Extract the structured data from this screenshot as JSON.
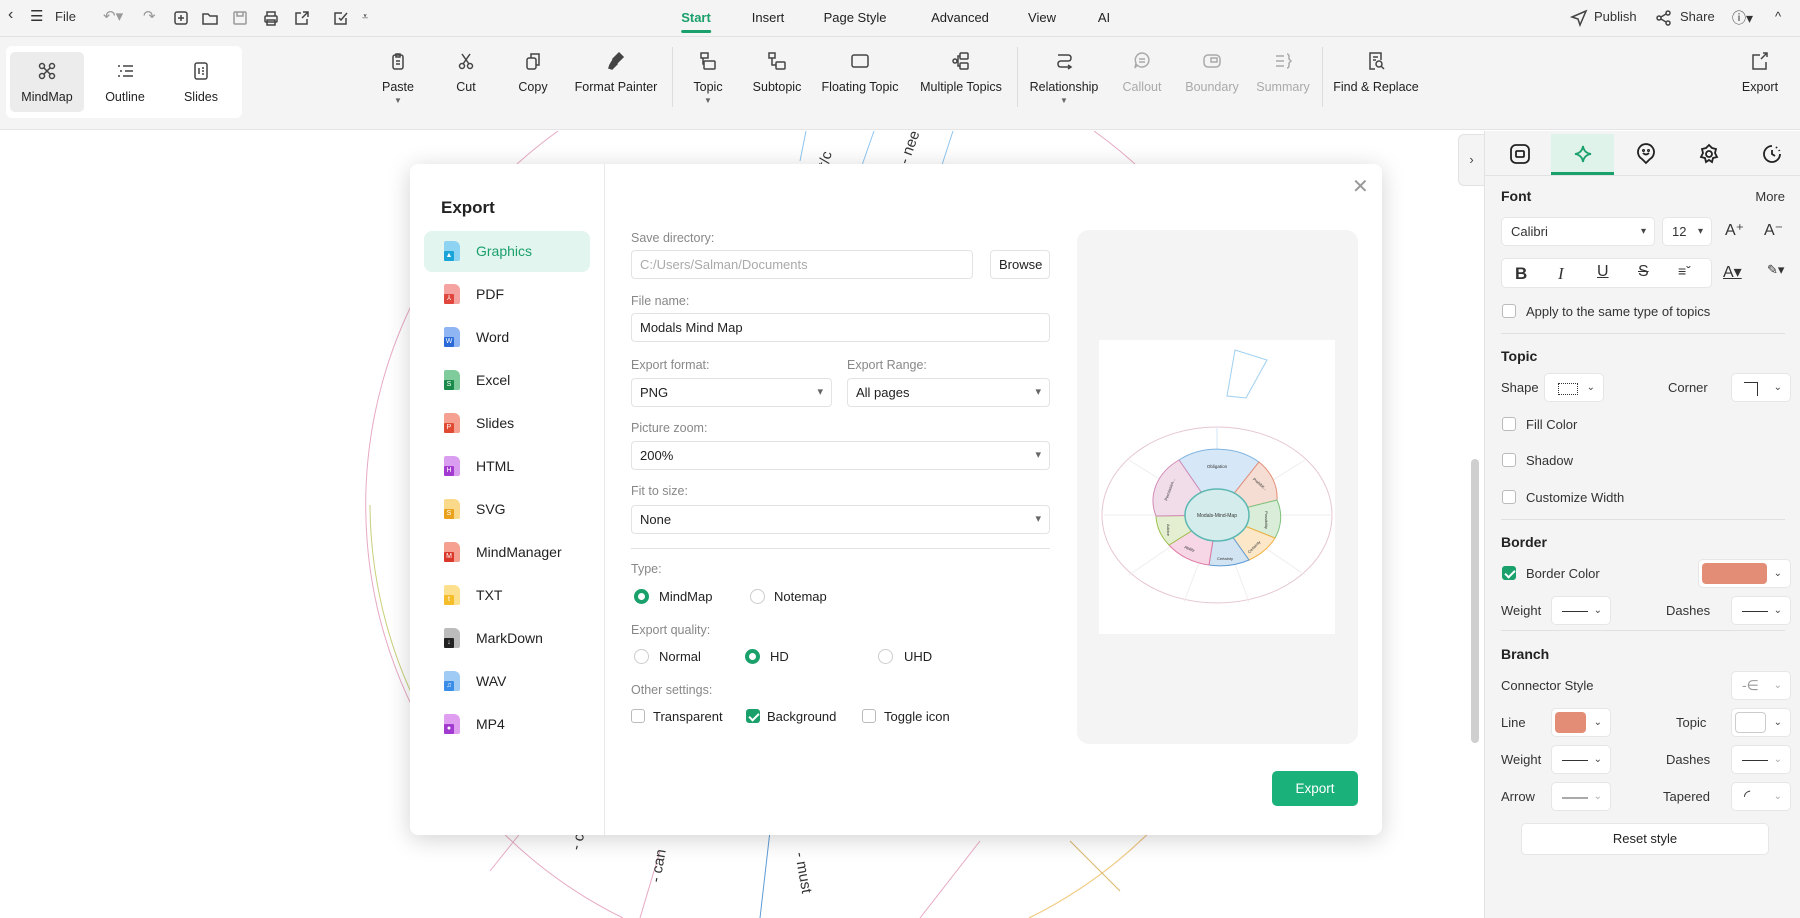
{
  "topbar": {
    "file": "File",
    "tabs": [
      "Start",
      "Insert",
      "Page Style",
      "Advanced",
      "View",
      "AI"
    ],
    "active_tab": "Start",
    "publish": "Publish",
    "share": "Share"
  },
  "views": [
    "MindMap",
    "Outline",
    "Slides"
  ],
  "ribbon": {
    "paste": "Paste",
    "cut": "Cut",
    "copy": "Copy",
    "format_painter": "Format Painter",
    "topic": "Topic",
    "subtopic": "Subtopic",
    "floating_topic": "Floating Topic",
    "multiple_topics": "Multiple Topics",
    "relationship": "Relationship",
    "callout": "Callout",
    "boundary": "Boundary",
    "summary": "Summary",
    "find_replace": "Find & Replace",
    "export": "Export"
  },
  "canvas": {
    "labels": [
      "- cou",
      "- can",
      "- must",
      "n't/c",
      "- nee"
    ]
  },
  "dialog": {
    "title": "Export",
    "formats": [
      "Graphics",
      "PDF",
      "Word",
      "Excel",
      "Slides",
      "HTML",
      "SVG",
      "MindManager",
      "TXT",
      "MarkDown",
      "WAV",
      "MP4"
    ],
    "active_format": "Graphics",
    "save_dir_label": "Save directory:",
    "save_dir_placeholder": "C:/Users/Salman/Documents",
    "browse": "Browse",
    "file_name_label": "File name:",
    "file_name": "Modals Mind Map",
    "format_label": "Export format:",
    "format": "PNG",
    "range_label": "Export Range:",
    "range": "All pages",
    "zoom_label": "Picture zoom:",
    "zoom": "200%",
    "fit_label": "Fit to size:",
    "fit": "None",
    "type_label": "Type:",
    "types": [
      "MindMap",
      "Notemap"
    ],
    "type_selected": "MindMap",
    "quality_label": "Export quality:",
    "qualities": [
      "Normal",
      "HD",
      "UHD"
    ],
    "quality_selected": "HD",
    "other_label": "Other settings:",
    "other": [
      {
        "label": "Transparent",
        "checked": false
      },
      {
        "label": "Background",
        "checked": true
      },
      {
        "label": "Toggle icon",
        "checked": false
      }
    ],
    "export_button": "Export",
    "preview": {
      "center": "Modals-Mind-Map",
      "branches": [
        "Obligation",
        "Prohibit...",
        "Possibility",
        "Certainty",
        "Certainty",
        "Ability",
        "Advice",
        "Permission..."
      ]
    }
  },
  "panel": {
    "font": {
      "heading": "Font",
      "more": "More",
      "family": "Calibri",
      "size": "12",
      "apply_same": "Apply to the same type of topics"
    },
    "topic": {
      "heading": "Topic",
      "shape": "Shape",
      "corner": "Corner",
      "fill_color": "Fill Color",
      "shadow": "Shadow",
      "customize_width": "Customize Width"
    },
    "border": {
      "heading": "Border",
      "border_color": "Border Color",
      "border_color_checked": true,
      "color": "#e38d77",
      "weight": "Weight",
      "dashes": "Dashes"
    },
    "branch": {
      "heading": "Branch",
      "connector_style": "Connector Style",
      "line": "Line",
      "line_color": "#e38d77",
      "topic": "Topic",
      "topic_color": "#ffffff",
      "weight": "Weight",
      "dashes": "Dashes",
      "arrow": "Arrow",
      "tapered": "Tapered"
    },
    "reset": "Reset style"
  },
  "colors": {
    "accent": "#1aa06b"
  }
}
